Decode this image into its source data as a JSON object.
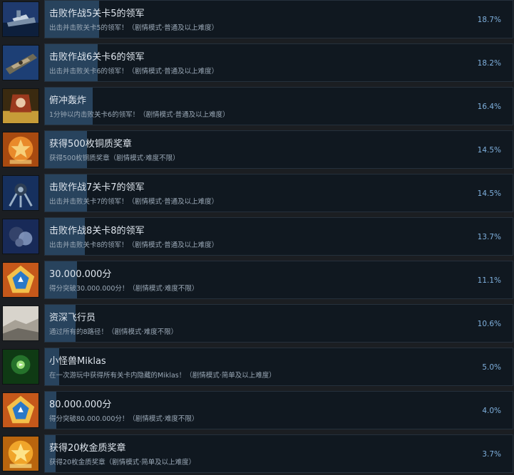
{
  "achievements": [
    {
      "title": "击败作战5关卡5的领军",
      "desc": "出击并击败关卡5的领军！（剧情模式·普通及以上难度）",
      "percent_text": "18.7%",
      "percent": 18.7,
      "icon": "ship-icon",
      "colors": [
        "#1f3a6e",
        "#7a8fa8",
        "#c7d3e0"
      ]
    },
    {
      "title": "击败作战6关卡6的领军",
      "desc": "出击并击败关卡6的领军！（剧情模式·普通及以上难度）",
      "percent_text": "18.2%",
      "percent": 18.2,
      "icon": "battleship-icon",
      "colors": [
        "#1d3f75",
        "#6f6a55",
        "#b9a988"
      ]
    },
    {
      "title": "俯冲轰炸",
      "desc": "1分钟以内击败关卡6的领军！（剧情模式·普通及以上难度）",
      "percent_text": "16.4%",
      "percent": 16.4,
      "icon": "bomber-icon",
      "colors": [
        "#3a2a10",
        "#9b3a1e",
        "#e0b040"
      ]
    },
    {
      "title": "获得500枚铜质奖章",
      "desc": "获得500枚铜质奖章（剧情模式·难度不限）",
      "percent_text": "14.5%",
      "percent": 14.5,
      "icon": "bronze-medal-icon",
      "colors": [
        "#a84a10",
        "#e98a2a",
        "#f7d07a"
      ]
    },
    {
      "title": "击败作战7关卡7的领军",
      "desc": "出击并击败关卡7的领军！（剧情模式·普通及以上难度）",
      "percent_text": "14.5%",
      "percent": 14.5,
      "icon": "mech-icon",
      "colors": [
        "#16305e",
        "#2e3f55",
        "#9ab0c6"
      ]
    },
    {
      "title": "击败作战8关卡8的领军",
      "desc": "出击并击败关卡8的领军！（剧情模式·普通及以上难度）",
      "percent_text": "13.7%",
      "percent": 13.7,
      "icon": "creature-icon",
      "colors": [
        "#182a58",
        "#34436a",
        "#8ea2c9"
      ]
    },
    {
      "title": "30.000.000分",
      "desc": "得分突破30.000.000分！（剧情模式·难度不限）",
      "percent_text": "11.1%",
      "percent": 11.1,
      "icon": "score-badge-icon",
      "colors": [
        "#c5581a",
        "#2a78c8",
        "#f3c04a"
      ]
    },
    {
      "title": "资深飞行员",
      "desc": "通过所有的8路径！（剧情模式·难度不限）",
      "percent_text": "10.6%",
      "percent": 10.6,
      "icon": "landscape-icon",
      "colors": [
        "#6e6a62",
        "#a7a196",
        "#d8d4cc"
      ]
    },
    {
      "title": "小怪兽Miklas",
      "desc": "在一次游玩中获得所有关卡内隐藏的Miklas！（剧情模式·简单及以上难度）",
      "percent_text": "5.0%",
      "percent": 5.0,
      "icon": "monster-icon",
      "colors": [
        "#0f3a14",
        "#2f8a34",
        "#9be07a"
      ]
    },
    {
      "title": "80.000.000分",
      "desc": "得分突破80.000.000分！（剧情模式·难度不限）",
      "percent_text": "4.0%",
      "percent": 4.0,
      "icon": "score-badge-icon",
      "colors": [
        "#c5581a",
        "#2a78c8",
        "#f3c04a"
      ]
    },
    {
      "title": "获得20枚金质奖章",
      "desc": "获得20枚金质奖章（剧情模式·简单及以上难度）",
      "percent_text": "3.7%",
      "percent": 3.7,
      "icon": "gold-medal-icon",
      "colors": [
        "#b9650e",
        "#f0a52a",
        "#fde48a"
      ]
    }
  ]
}
